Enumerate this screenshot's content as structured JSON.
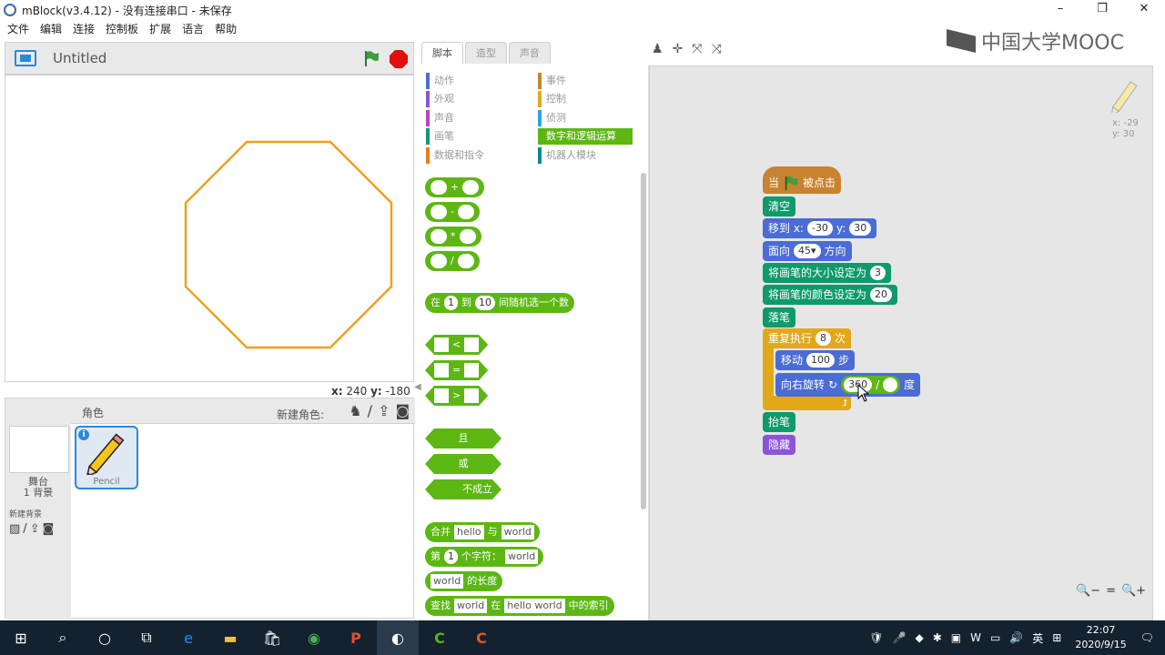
{
  "window": {
    "title": "mBlock(v3.4.12) - 没有连接串口 - 未保存",
    "min": "–",
    "max": "❐",
    "close": "✕"
  },
  "menu": [
    "文件",
    "编辑",
    "连接",
    "控制板",
    "扩展",
    "语言",
    "帮助"
  ],
  "watermark": "中国大学MOOC",
  "stage": {
    "project_title": "Untitled",
    "coord_x_label": "x:",
    "coord_x": "240",
    "coord_y_label": "y:",
    "coord_y": "-180",
    "octagon_color": "#f0a020"
  },
  "sprites": {
    "header": "角色",
    "new_sprite": "新建角色:",
    "stage_label_1": "舞台",
    "stage_label_2": "1 背景",
    "new_backdrop": "新建背景",
    "sprite_name": "Pencil",
    "info": "i"
  },
  "tabs": [
    "脚本",
    "造型",
    "声音"
  ],
  "categories": [
    {
      "label": "动作",
      "color": "#4a6cd4"
    },
    {
      "label": "外观",
      "color": "#8a55d7"
    },
    {
      "label": "声音",
      "color": "#bb42c3"
    },
    {
      "label": "画笔",
      "color": "#0e9a6c"
    },
    {
      "label": "数据和指令",
      "color": "#ee7d16"
    },
    {
      "label": "事件",
      "color": "#c88330"
    },
    {
      "label": "控制",
      "color": "#e1a91a"
    },
    {
      "label": "侦测",
      "color": "#2ca5e2"
    },
    {
      "label": "数字和逻辑运算",
      "color": "#5cb712"
    },
    {
      "label": "机器人模块",
      "color": "#0a8698"
    }
  ],
  "palette": {
    "op_plus": "+",
    "op_minus": "-",
    "op_times": "*",
    "op_div": "/",
    "random_1": "在",
    "random_from": "1",
    "random_2": "到",
    "random_to": "10",
    "random_3": "间随机选一个数",
    "lt": "<",
    "eq": "=",
    "gt": ">",
    "and": "且",
    "or": "或",
    "not": "不成立",
    "join_1": "合并",
    "join_a": "hello",
    "join_2": "与",
    "join_b": "world",
    "letter_1": "第",
    "letter_n": "1",
    "letter_2": "个字符：",
    "letter_s": "world",
    "length_s": "world",
    "length_2": "的长度",
    "find_1": "查找",
    "find_a": "world",
    "find_2": "在",
    "find_b": "hello world",
    "find_3": "中的索引"
  },
  "script_tools": [
    "♟",
    "✛",
    "⤧",
    "⤨"
  ],
  "script": {
    "hat_1": "当",
    "hat_2": "被点击",
    "clear": "清空",
    "goto_1": "移到 x:",
    "goto_x": "-30",
    "goto_2": "y:",
    "goto_y": "30",
    "point_1": "面向",
    "point_v": "45▾",
    "point_2": "方向",
    "size_1": "将画笔的大小设定为",
    "size_v": "3",
    "color_1": "将画笔的颜色设定为",
    "color_v": "20",
    "pendown": "落笔",
    "repeat_1": "重复执行",
    "repeat_v": "8",
    "repeat_2": "次",
    "move_1": "移动",
    "move_v": "100",
    "move_2": "步",
    "turn_1": "向右旋转",
    "turn_icon": "↻",
    "turn_a": "360",
    "turn_op": "/",
    "turn_2": "度",
    "penup": "抬笔",
    "hide": "隐藏"
  },
  "pencil_coords": {
    "x": "x: -29",
    "y": "y: 30"
  },
  "zoom": [
    "🔍−",
    "=",
    "🔍+"
  ],
  "taskbar": {
    "items": [
      "⊞",
      "⌕",
      "○",
      "⧉",
      "e",
      "▬",
      "🛍",
      "◉",
      "P",
      "◐",
      "C",
      "C"
    ],
    "tray": [
      "🛡",
      "🎤",
      "◆",
      "✱",
      "▣",
      "W",
      "▭",
      "🔊",
      "英",
      "⊞"
    ],
    "time": "22:07",
    "date": "2020/9/15",
    "notify": "🗨"
  }
}
